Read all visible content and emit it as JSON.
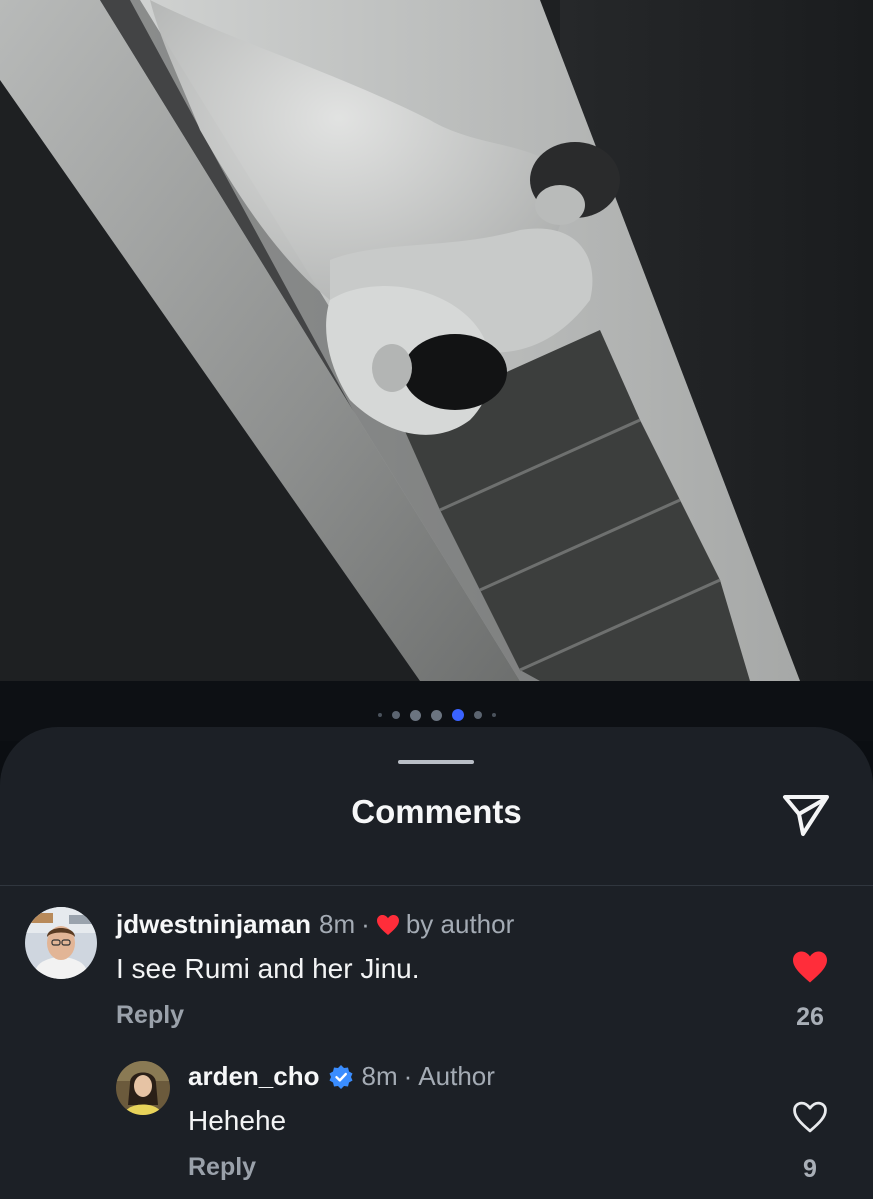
{
  "carousel": {
    "dot_count": 7,
    "active_index": 4
  },
  "sheet": {
    "title": "Comments",
    "send_icon": "send-icon"
  },
  "comments": [
    {
      "username": "jdwestninjaman",
      "time": "8m",
      "separator": "·",
      "liked_by_author": "by author",
      "text": "I see Rumi and her Jinu.",
      "reply_label": "Reply",
      "likes": "26",
      "liked": true
    },
    {
      "username": "arden_cho",
      "verified": true,
      "time": "8m",
      "separator": "·",
      "author_label": "Author",
      "text": "Hehehe",
      "reply_label": "Reply",
      "likes": "9",
      "liked": false
    }
  ],
  "colors": {
    "like_red": "#ff2d3a",
    "verified_blue": "#3a8dff",
    "active_dot": "#3a63ff",
    "sheet_bg": "#1c2026"
  }
}
